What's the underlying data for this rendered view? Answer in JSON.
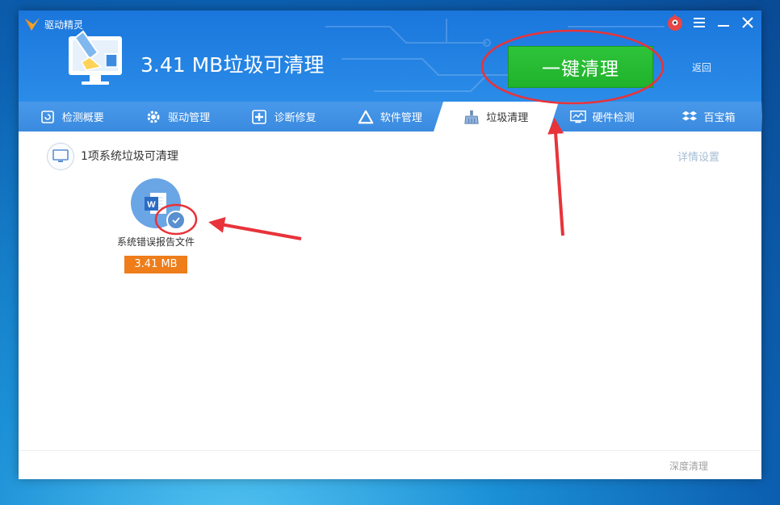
{
  "app": {
    "name": "驱动精灵"
  },
  "header": {
    "headline": "3.41 MB垃圾可清理",
    "clean_button": "一键清理",
    "back": "返回"
  },
  "tabs": [
    {
      "label": "检测概要",
      "icon": "refresh-icon"
    },
    {
      "label": "驱动管理",
      "icon": "gear-icon"
    },
    {
      "label": "诊断修复",
      "icon": "medical-cross-icon"
    },
    {
      "label": "软件管理",
      "icon": "triangle-logo-icon"
    },
    {
      "label": "垃圾清理",
      "icon": "broom-icon",
      "active": true
    },
    {
      "label": "硬件检测",
      "icon": "monitor-chart-icon"
    },
    {
      "label": "百宝箱",
      "icon": "box-icon"
    }
  ],
  "content": {
    "section_title": "1项系统垃圾可清理",
    "detail_settings": "详情设置",
    "items": [
      {
        "name": "系统错误报告文件",
        "size": "3.41 MB",
        "icon": "word-document-icon",
        "checked": true
      }
    ]
  },
  "footer": {
    "deep_clean": "深度清理"
  },
  "colors": {
    "header_blue": "#1a76dc",
    "tab_blue": "#3b8fe4",
    "clean_green": "#26bb33",
    "size_orange": "#ee7d1a",
    "annotation_red": "#e8333a"
  }
}
